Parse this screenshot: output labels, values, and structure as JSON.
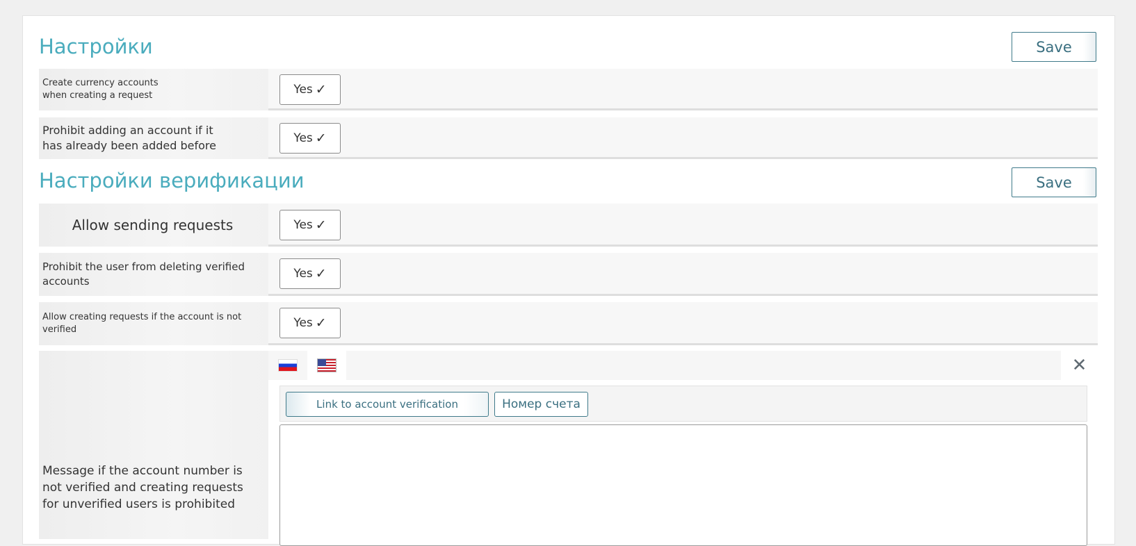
{
  "settings": {
    "title": "Настройки",
    "save_label": "Save",
    "rows": [
      {
        "label": "Create currency accounts when creating a request",
        "value": "Yes"
      },
      {
        "label": "Prohibit adding an account if it has already been added before",
        "value": "Yes"
      }
    ]
  },
  "verification": {
    "title": "Настройки верификации",
    "save_label": "Save",
    "rows": [
      {
        "label": "Allow sending requests",
        "value": "Yes"
      },
      {
        "label": "Prohibit the user from deleting verified accounts",
        "value": "Yes"
      },
      {
        "label": "Allow creating requests if the account is not verified",
        "value": "Yes"
      }
    ],
    "message": {
      "label": "Message if the account number is not verified and creating requests for unverified users is prohibited",
      "languages": [
        "ru-flag-icon",
        "us-flag-icon"
      ],
      "toolbar": {
        "link_button": "Link to account verification",
        "account_button": "Номер счета"
      },
      "text": ""
    }
  },
  "icons": {
    "check": "✓",
    "close": "✕"
  },
  "colors": {
    "title": "#4aacbd",
    "button_border": "#3f7a8a",
    "button_text": "#3a6f80"
  }
}
